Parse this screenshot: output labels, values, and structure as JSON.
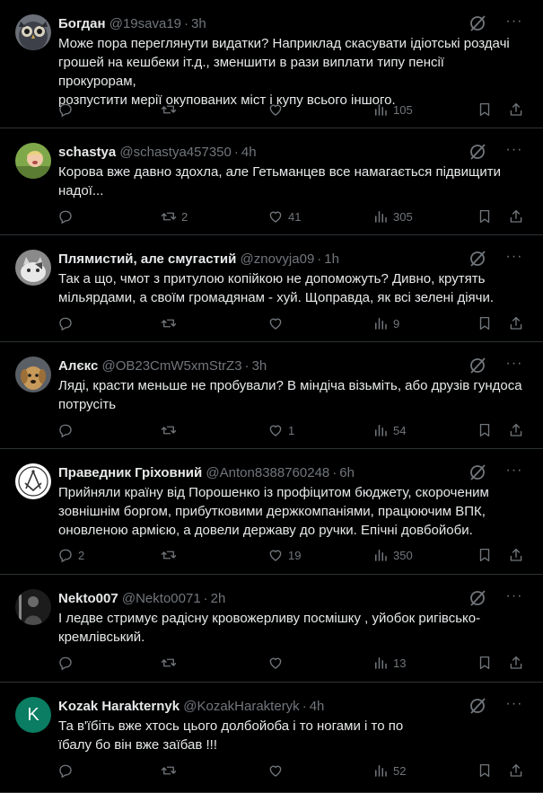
{
  "icons": {
    "reply": "reply-icon",
    "retweet": "retweet-icon",
    "like": "like-icon",
    "views": "views-icon",
    "bookmark": "bookmark-icon",
    "share": "share-icon",
    "grok": "grok-icon",
    "more": "more-icon"
  },
  "more_glyph": "···",
  "colors": {
    "background": "#000000",
    "text": "#e7e9ea",
    "muted": "#71767b",
    "divider": "#2f3336"
  },
  "tweets": [
    {
      "name": "Богдан",
      "handle": "@19sava19",
      "sep": "·",
      "time": "3h",
      "lines": [
        "Може пора переглянути видатки? Наприклад скасувати ідіотські роздачі",
        "грошей на кешбеки іт.д., зменшити в рази виплати типу пенсії прокурорам,",
        "розпустити мерії окупованих міст і купу всього іншого."
      ],
      "replies": "",
      "retweets": "",
      "likes": "",
      "views": "105"
    },
    {
      "name": "schastya",
      "handle": "@schastya457350",
      "sep": "·",
      "time": "4h",
      "lines": [
        "Корова вже давно здохла, але Гетьманцев все намагається підвищити",
        "надої..."
      ],
      "replies": "",
      "retweets": "2",
      "likes": "41",
      "views": "305"
    },
    {
      "name": "Плямистий, але смугастий",
      "handle": "@znovyja09",
      "sep": "·",
      "time": "1h",
      "lines": [
        "Так а що, чмот з притулою копійкою не допоможуть? Дивно, крутять",
        "мільярдами, а своїм громадянам - хуй. Щоправда, як всі зелені діячи."
      ],
      "replies": "",
      "retweets": "",
      "likes": "",
      "views": "9"
    },
    {
      "name": "Алєкс",
      "handle": "@OB23CmW5xmStrZ3",
      "sep": "·",
      "time": "3h",
      "lines": [
        "Ляді, красти меньше не пробували? В міндіча візьміть, або друзів гундоса",
        "потрусіть"
      ],
      "replies": "",
      "retweets": "",
      "likes": "1",
      "views": "54"
    },
    {
      "name": "Праведник Гріховний",
      "handle": "@Anton8388760248",
      "sep": "·",
      "time": "6h",
      "lines": [
        "Прийняли країну від Порошенко із профіцитом бюджету, скороченим",
        "зовнішнім боргом, прибутковими держкомпаніями, працюючим ВПК,",
        "оновленою армією, а довели державу до ручки. Епічні довбойоби."
      ],
      "replies": "2",
      "retweets": "",
      "likes": "19",
      "views": "350"
    },
    {
      "name": "Nekto007",
      "handle": "@Nekto0071",
      "sep": "·",
      "time": "2h",
      "lines": [
        "І ледве стримує радісну кровожерливу посмішку , уйобок ригівсько-",
        "кремлівський."
      ],
      "replies": "",
      "retweets": "",
      "likes": "",
      "views": "13"
    },
    {
      "name": "Kozak Harakternyk",
      "handle": "@KozakHarakteryk",
      "sep": "·",
      "time": "4h",
      "avatar_letter": "K",
      "lines": [
        "Та в'їбіть вже хтось цього долбойоба і то ногами і то по",
        "їбалу бо він вже заїбав !!!"
      ],
      "replies": "",
      "retweets": "",
      "likes": "",
      "views": "52"
    }
  ]
}
